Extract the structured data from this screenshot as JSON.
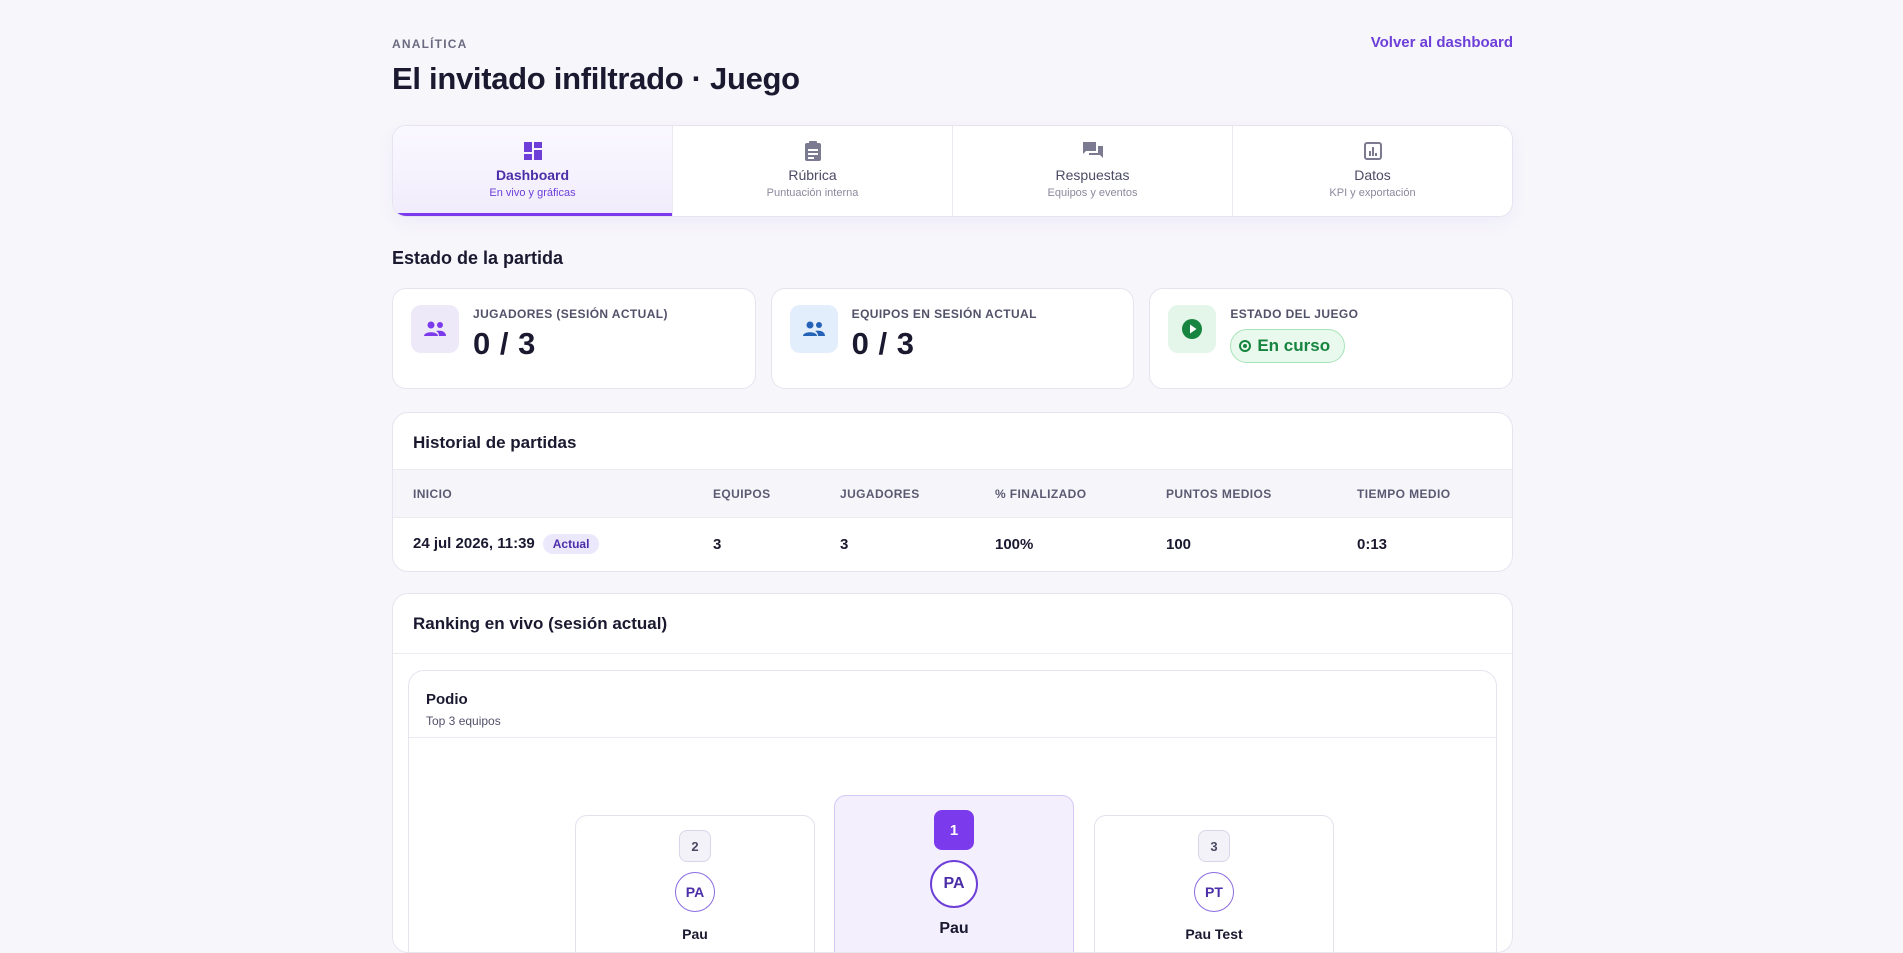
{
  "header": {
    "eyebrow": "ANALÍTICA",
    "title": "El invitado infiltrado · Juego",
    "back_link": "Volver al dashboard"
  },
  "tabs": [
    {
      "label": "Dashboard",
      "sub": "En vivo y gráficas",
      "icon": "dashboard-icon",
      "active": true
    },
    {
      "label": "Rúbrica",
      "sub": "Puntuación interna",
      "icon": "clipboard-icon",
      "active": false
    },
    {
      "label": "Respuestas",
      "sub": "Equipos y eventos",
      "icon": "chat-icon",
      "active": false
    },
    {
      "label": "Datos",
      "sub": "KPI y exportación",
      "icon": "chart-icon",
      "active": false
    }
  ],
  "status_section": {
    "title": "Estado de la partida",
    "cards": [
      {
        "label": "JUGADORES (SESIÓN ACTUAL)",
        "value": "0 / 3",
        "icon": "people-icon"
      },
      {
        "label": "EQUIPOS EN SESIÓN ACTUAL",
        "value": "0 / 3",
        "icon": "people-icon"
      },
      {
        "label": "ESTADO DEL JUEGO",
        "value": "En curso",
        "icon": "play-icon"
      }
    ]
  },
  "history": {
    "title": "Historial de partidas",
    "columns": [
      "INICIO",
      "EQUIPOS",
      "JUGADORES",
      "% FINALIZADO",
      "PUNTOS MEDIOS",
      "TIEMPO MEDIO"
    ],
    "rows": [
      {
        "inicio": "24 jul 2026, 11:39",
        "badge": "Actual",
        "equipos": "3",
        "jugadores": "3",
        "finalizado": "100%",
        "puntos": "100",
        "tiempo": "0:13"
      }
    ]
  },
  "ranking": {
    "title": "Ranking en vivo (sesión actual)",
    "podium_title": "Podio",
    "podium_sub": "Top 3 equipos",
    "podium": [
      {
        "rank": "2",
        "initials": "PA",
        "name": "Pau"
      },
      {
        "rank": "1",
        "initials": "PA",
        "name": "Pau"
      },
      {
        "rank": "3",
        "initials": "PT",
        "name": "Pau Test"
      }
    ]
  },
  "colors": {
    "accent": "#7c3aed",
    "success": "#17843f",
    "background": "#f7f6fb"
  }
}
